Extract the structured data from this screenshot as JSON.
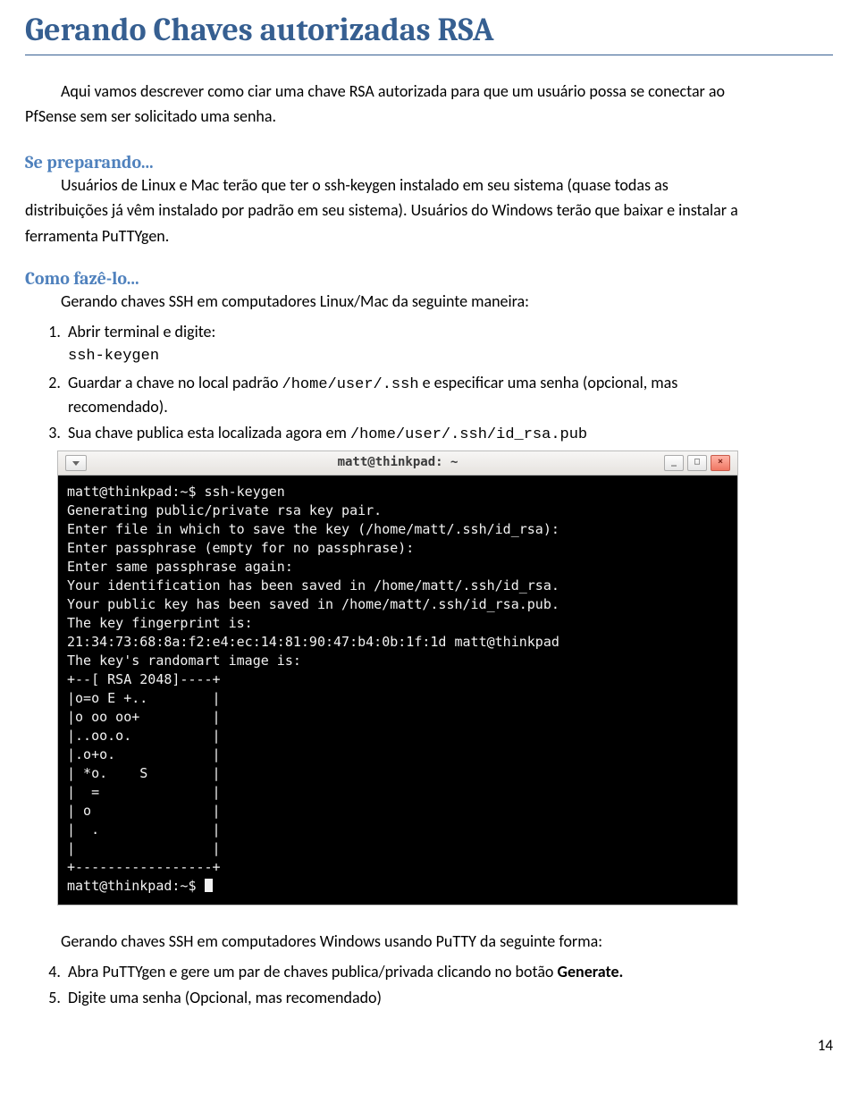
{
  "title": "Gerando Chaves autorizadas RSA",
  "intro_p1_line": "Aqui vamos descrever como ciar uma chave RSA autorizada para que um usuário possa se conectar ao",
  "intro_p1_line2": "PfSense sem ser solicitado uma senha.",
  "sec1_title": "Se preparando...",
  "sec1_p1": "Usuários de Linux e Mac terão que ter o ssh-keygen instalado em seu sistema (quase todas as",
  "sec1_p2": "distribuições já vêm instalado por padrão em seu sistema). Usuários do Windows terão que baixar e instalar a",
  "sec1_p3": "ferramenta PuTTYgen.",
  "sec2_title": "Como fazê-lo...",
  "sec2_lead": "Gerando chaves SSH em computadores Linux/Mac da seguinte maneira:",
  "step1": "Abrir terminal e digite:",
  "step1_cmd": "ssh-keygen",
  "step2_a": "Guardar a chave no local padrão ",
  "step2_path": "/home/user/.ssh",
  "step2_b": "  e especificar uma senha (opcional, mas",
  "step2_c": "recomendado).",
  "step3_a": "Sua chave publica esta localizada agora em ",
  "step3_path": "/home/user/.ssh/id_rsa.pub",
  "term_title": "matt@thinkpad: ~",
  "term_line01": "matt@thinkpad:~$ ssh-keygen",
  "term_line02": "Generating public/private rsa key pair.",
  "term_line03": "Enter file in which to save the key (/home/matt/.ssh/id_rsa):",
  "term_line04": "Enter passphrase (empty for no passphrase):",
  "term_line05": "Enter same passphrase again:",
  "term_line06": "Your identification has been saved in /home/matt/.ssh/id_rsa.",
  "term_line07": "Your public key has been saved in /home/matt/.ssh/id_rsa.pub.",
  "term_line08": "The key fingerprint is:",
  "term_line09": "21:34:73:68:8a:f2:e4:ec:14:81:90:47:b4:0b:1f:1d matt@thinkpad",
  "term_line10": "The key's randomart image is:",
  "term_line11": "+--[ RSA 2048]----+",
  "term_line12": "|o=o E +..        |",
  "term_line13": "|o oo oo+         |",
  "term_line14": "|..oo.o.          |",
  "term_line15": "|.o+o.            |",
  "term_line16": "| *o.    S        |",
  "term_line17": "|  =              |",
  "term_line18": "| o               |",
  "term_line19": "|  .              |",
  "term_line20": "|                 |",
  "term_line21": "+-----------------+",
  "term_prompt_end": "matt@thinkpad:~$ ",
  "after_lead": "Gerando chaves SSH em computadores Windows usando PuTTY da seguinte forma:",
  "step4_a": "Abra PuTTYgen e gere um par de chaves publica/privada clicando no botão ",
  "step4_b": "Generate.",
  "step5": "Digite uma senha (Opcional, mas recomendado)",
  "pagenum": "14"
}
